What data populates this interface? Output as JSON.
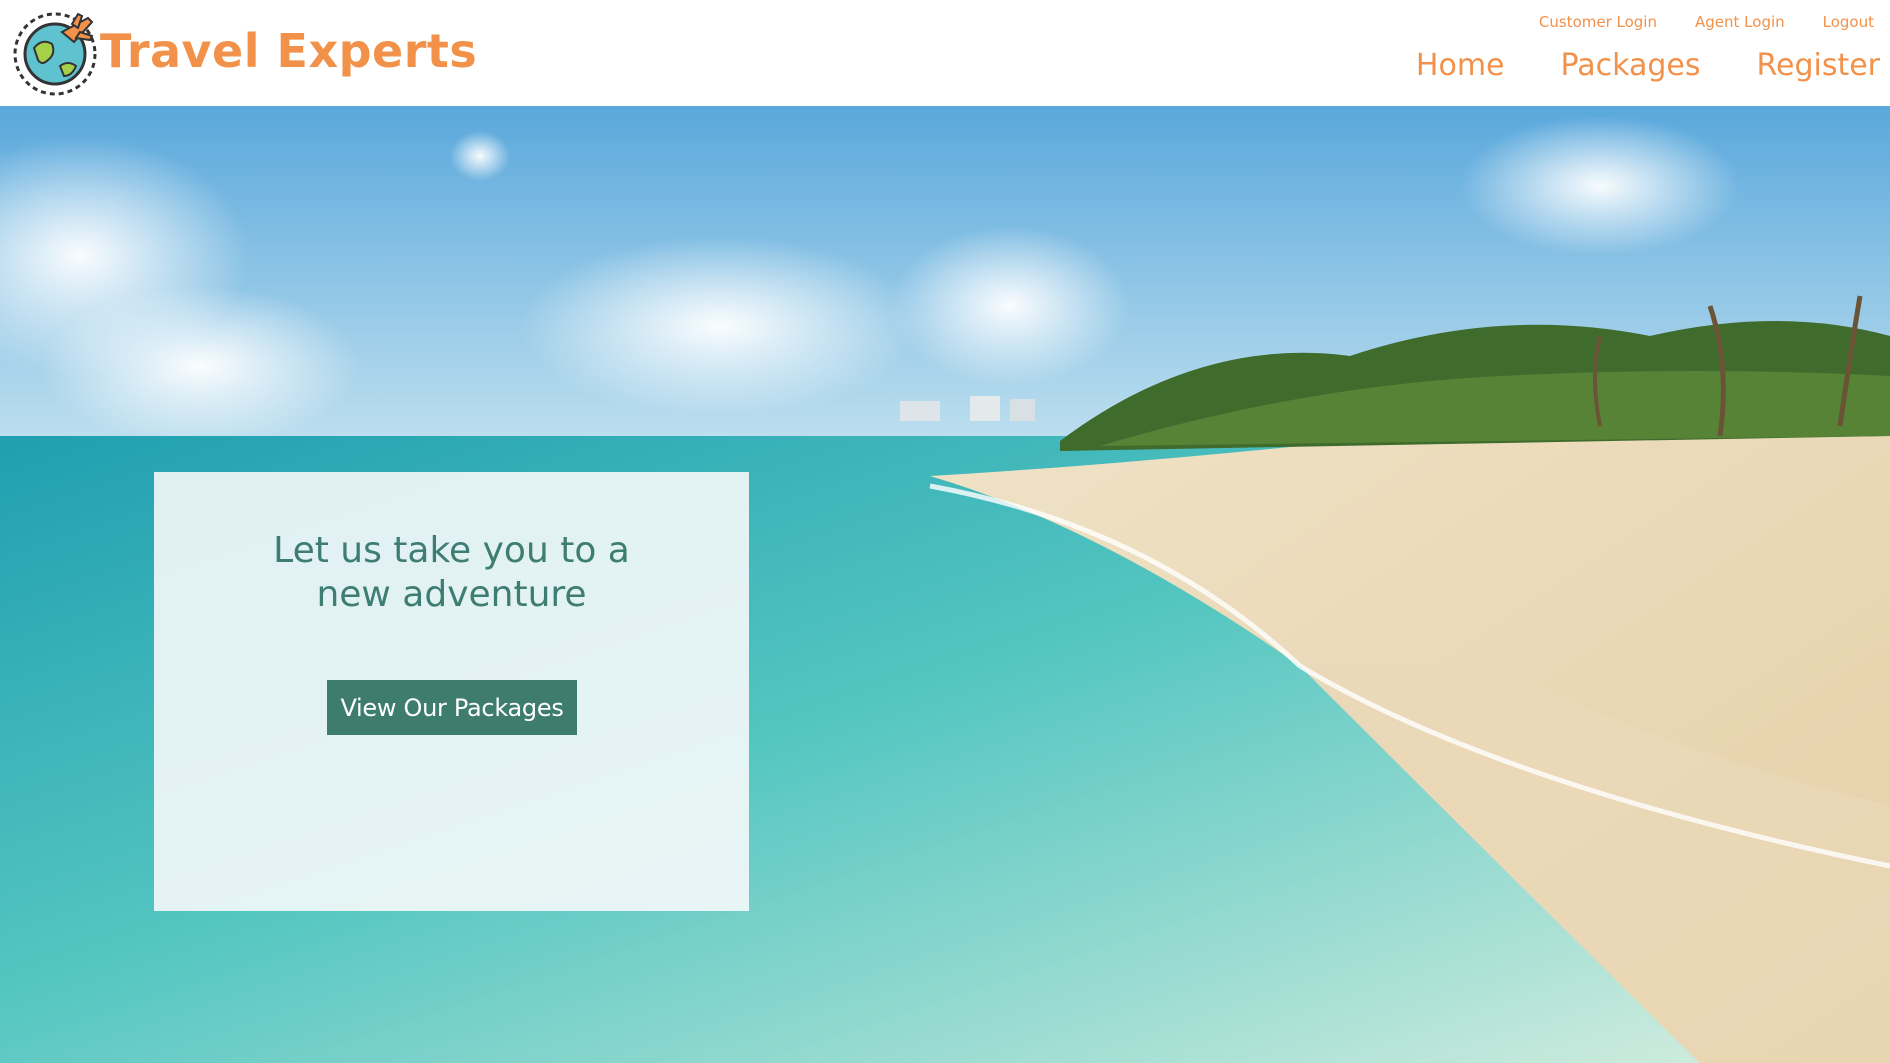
{
  "brand": {
    "name": "Travel Experts",
    "logo_icon": "globe-airplane-icon"
  },
  "util_nav": {
    "customer_login": "Customer Login",
    "agent_login": "Agent Login",
    "logout": "Logout"
  },
  "main_nav": {
    "home": "Home",
    "packages": "Packages",
    "register": "Register"
  },
  "hero": {
    "tagline_line1": "Let us take you to a",
    "tagline_line2": "new adventure",
    "cta_label": "View Our Packages"
  },
  "colors": {
    "accent": "#f2914a",
    "teal": "#3e7d73",
    "button": "#3e7d6e"
  }
}
